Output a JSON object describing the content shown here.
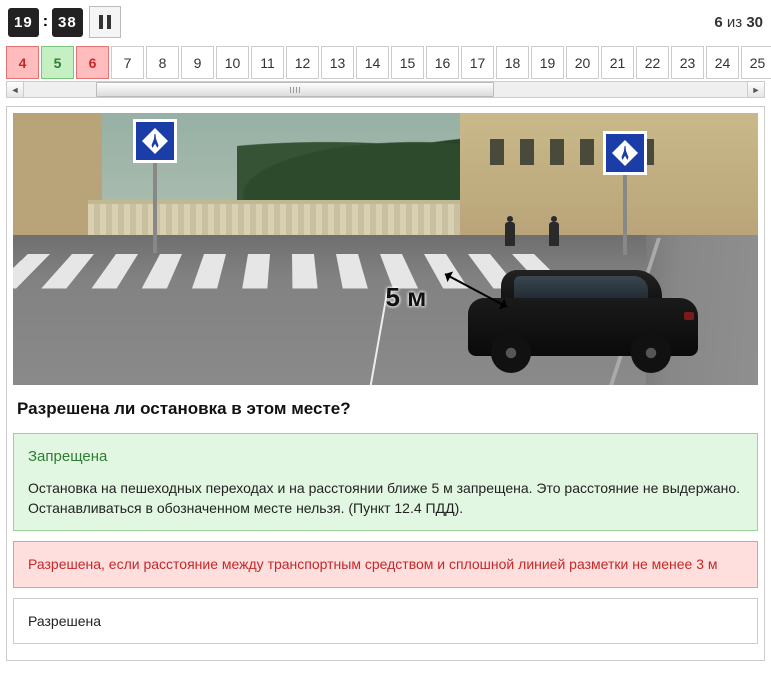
{
  "timer": {
    "minutes": "19",
    "seconds": "38"
  },
  "progress": {
    "current": "6",
    "sep": "из",
    "total": "30"
  },
  "nav": [
    {
      "n": "4",
      "status": "wrong"
    },
    {
      "n": "5",
      "status": "correct"
    },
    {
      "n": "6",
      "status": "current"
    },
    {
      "n": "7",
      "status": ""
    },
    {
      "n": "8",
      "status": ""
    },
    {
      "n": "9",
      "status": ""
    },
    {
      "n": "10",
      "status": ""
    },
    {
      "n": "11",
      "status": ""
    },
    {
      "n": "12",
      "status": ""
    },
    {
      "n": "13",
      "status": ""
    },
    {
      "n": "14",
      "status": ""
    },
    {
      "n": "15",
      "status": ""
    },
    {
      "n": "16",
      "status": ""
    },
    {
      "n": "17",
      "status": ""
    },
    {
      "n": "18",
      "status": ""
    },
    {
      "n": "19",
      "status": ""
    },
    {
      "n": "20",
      "status": ""
    },
    {
      "n": "21",
      "status": ""
    },
    {
      "n": "22",
      "status": ""
    },
    {
      "n": "23",
      "status": ""
    },
    {
      "n": "24",
      "status": ""
    },
    {
      "n": "25",
      "status": ""
    }
  ],
  "scene": {
    "distance_label": "5 м",
    "sign_left": "pedestrian-crossing-sign",
    "sign_right": "pedestrian-crossing-sign"
  },
  "question": "Разрешена ли остановка в этом месте?",
  "answers": [
    {
      "title": "Запрещена",
      "explanation": "Остановка на пешеходных переходах и на расстоянии ближе 5 м запрещена. Это расстояние не выдержано. Останавливаться в обозначенном месте нельзя. (Пункт 12.4 ПДД).",
      "status": "correct"
    },
    {
      "title": "Разрешена, если расстояние между транспортным средством и сплошной линией разметки не менее 3 м",
      "status": "wrong"
    },
    {
      "title": "Разрешена",
      "status": "neutral"
    }
  ]
}
